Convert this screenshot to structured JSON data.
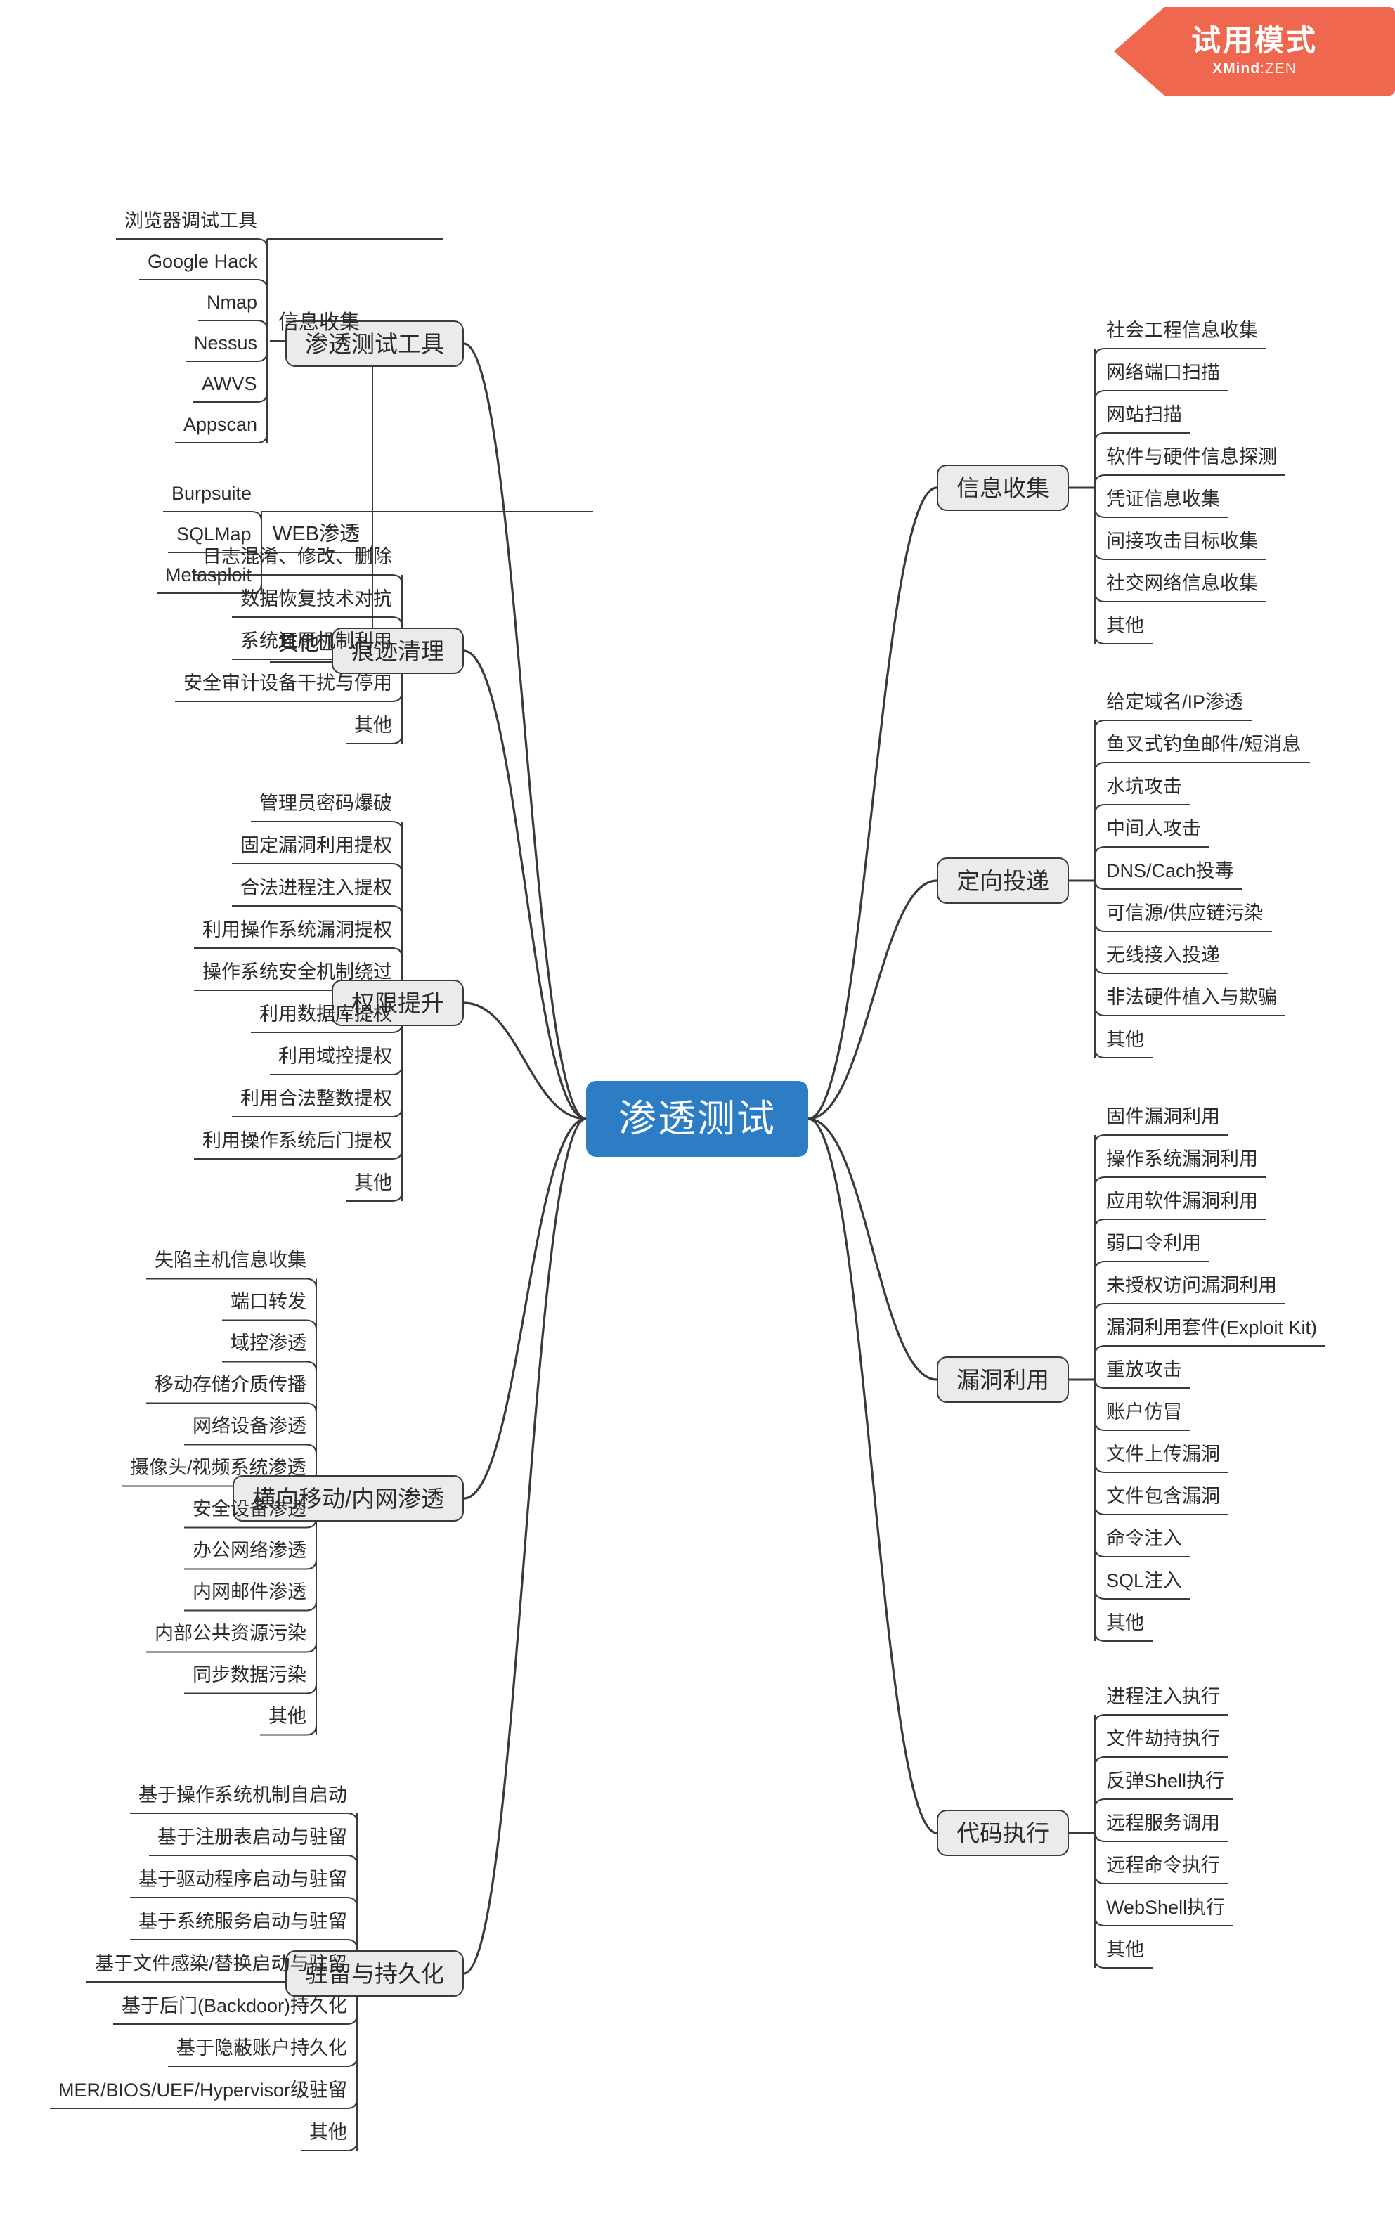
{
  "app": {
    "trial_badge_title": "试用模式",
    "trial_badge_brand_bold": "XMind",
    "trial_badge_brand_rest": ":ZEN",
    "accent_root": "#2d7dc4",
    "accent_trial": "#f0674f",
    "main_node_fill": "#ebebeb",
    "line_color": "#3a3a3a"
  },
  "mindmap": {
    "type": "mindmap",
    "root": "渗透测试",
    "branches": [
      {
        "id": "tools",
        "label": "渗透测试工具",
        "side": "left",
        "subgroups": [
          {
            "label": "信息收集",
            "items": [
              "浏览器调试工具",
              "Google Hack",
              "Nmap",
              "Nessus",
              "AWVS",
              "Appscan"
            ]
          },
          {
            "label": "WEB渗透",
            "items": [
              "Burpsuite",
              "SQLMap",
              "Metasploit"
            ]
          },
          {
            "label": "其他工具",
            "items": []
          }
        ]
      },
      {
        "id": "trace-cleanup",
        "label": "痕迹清理",
        "side": "left",
        "items": [
          "日志混淆、修改、删除",
          "数据恢复技术对抗",
          "系统还原机制利用",
          "安全审计设备干扰与停用",
          "其他"
        ]
      },
      {
        "id": "privilege-escalation",
        "label": "权限提升",
        "side": "left",
        "items": [
          "管理员密码爆破",
          "固定漏洞利用提权",
          "合法进程注入提权",
          "利用操作系统漏洞提权",
          "操作系统安全机制绕过",
          "利用数据库提权",
          "利用域控提权",
          "利用合法整数提权",
          "利用操作系统后门提权",
          "其他"
        ]
      },
      {
        "id": "lateral-movement",
        "label": "横向移动/内网渗透",
        "side": "left",
        "items": [
          "失陷主机信息收集",
          "端口转发",
          "域控渗透",
          "移动存储介质传播",
          "网络设备渗透",
          "摄像头/视频系统渗透",
          "安全设备渗透",
          "办公网络渗透",
          "内网邮件渗透",
          "内部公共资源污染",
          "同步数据污染",
          "其他"
        ]
      },
      {
        "id": "persistence",
        "label": "驻留与持久化",
        "side": "left",
        "items": [
          "基于操作系统机制自启动",
          "基于注册表启动与驻留",
          "基于驱动程序启动与驻留",
          "基于系统服务启动与驻留",
          "基于文件感染/替换启动与驻留",
          "基于后门(Backdoor)持久化",
          "基于隐蔽账户持久化",
          "MER/BIOS/UEF/Hypervisor级驻留",
          "其他"
        ]
      },
      {
        "id": "info-gathering",
        "label": "信息收集",
        "side": "right",
        "items": [
          "社会工程信息收集",
          "网络端口扫描",
          "网站扫描",
          "软件与硬件信息探测",
          "凭证信息收集",
          "间接攻击目标收集",
          "社交网络信息收集",
          "其他"
        ]
      },
      {
        "id": "targeted-delivery",
        "label": "定向投递",
        "side": "right",
        "items": [
          "给定域名/IP渗透",
          "鱼叉式钓鱼邮件/短消息",
          "水坑攻击",
          "中间人攻击",
          "DNS/Cach投毒",
          "可信源/供应链污染",
          "无线接入投递",
          "非法硬件植入与欺骗",
          "其他"
        ]
      },
      {
        "id": "exploitation",
        "label": "漏洞利用",
        "side": "right",
        "items": [
          "固件漏洞利用",
          "操作系统漏洞利用",
          "应用软件漏洞利用",
          "弱口令利用",
          "未授权访问漏洞利用",
          "漏洞利用套件(Exploit Kit)",
          "重放攻击",
          "账户仿冒",
          "文件上传漏洞",
          "文件包含漏洞",
          "命令注入",
          "SQL注入",
          "其他"
        ]
      },
      {
        "id": "code-execution",
        "label": "代码执行",
        "side": "right",
        "items": [
          "进程注入执行",
          "文件劫持执行",
          "反弹Shell执行",
          "远程服务调用",
          "远程命令执行",
          "WebShell执行",
          "其他"
        ]
      }
    ]
  }
}
